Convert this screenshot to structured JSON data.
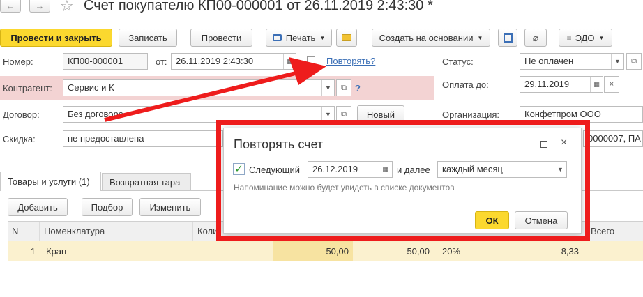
{
  "window": {
    "title": "Счет покупателю КП00-000001 от 26.11.2019 2:43:30 *",
    "nav_back": "←",
    "nav_forward": "→",
    "favorite": "☆"
  },
  "toolbar": {
    "post_close": "Провести и закрыть",
    "save": "Записать",
    "post": "Провести",
    "print": "Печать",
    "email_icon": "envelope-icon",
    "create_based": "Создать на основании",
    "edo": "ЭДО"
  },
  "header": {
    "number_label": "Номер:",
    "number_value": "КП00-000001",
    "date_label": "от:",
    "date_value": "26.11.2019  2:43:30",
    "repeat_link": "Повторять?",
    "status_label": "Статус:",
    "status_value": "Не оплачен",
    "counterparty_label": "Контрагент:",
    "counterparty_value": "Сервис и К",
    "pay_until_label": "Оплата до:",
    "pay_until_value": "29.11.2019",
    "contract_label": "Договор:",
    "contract_value": "Без договора",
    "new_button": "Новый",
    "org_label": "Организация:",
    "org_value": "Конфетпром ООО",
    "discount_label": "Скидка:",
    "discount_value": "не предоставлена",
    "account_partial": "0000007, ПА",
    "help": "?"
  },
  "tabs": [
    "Товары и услуги (1)",
    "Возвратная тара"
  ],
  "table_toolbar": {
    "add": "Добавить",
    "select": "Подбор",
    "change": "Изменить"
  },
  "table": {
    "columns": [
      "N",
      "Номенклатура",
      "Коли",
      "Всего"
    ],
    "rows": [
      {
        "n": "1",
        "name": "Кран",
        "price": "50,00",
        "sum": "50,00",
        "vat_rate": "20%",
        "vat_sum": "8,33"
      }
    ]
  },
  "dialog": {
    "title": "Повторять счет",
    "checkbox_label": "Следующий",
    "checkbox_checked": true,
    "next_date": "26.12.2019",
    "then_label": "и далее",
    "period_value": "каждый месяц",
    "hint": "Напоминание можно будет увидеть в списке документов",
    "ok": "ОК",
    "cancel": "Отмена"
  },
  "colors": {
    "accent_yellow": "#fbd82f",
    "counterparty_highlight": "#f3d3d3",
    "annotation_red": "#ee1c1c",
    "row_highlight": "#fbf1cf",
    "link_blue": "#3b6fb6"
  }
}
